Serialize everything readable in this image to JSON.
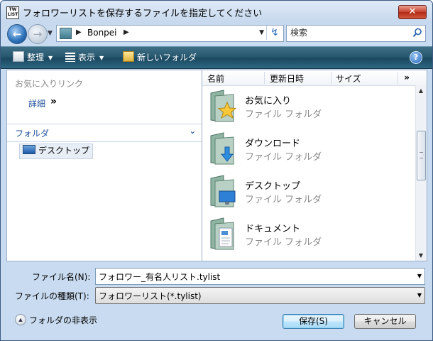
{
  "title": "フォロワーリストを保存するファイルを指定してください",
  "nav": {
    "path": [
      "Bonpei"
    ],
    "search_placeholder": "検索"
  },
  "toolbar": {
    "organize": "整理",
    "views": "表示",
    "new_folder": "新しいフォルダ"
  },
  "left": {
    "favorites_header": "お気に入りリンク",
    "details_label": "詳細",
    "details_chevron": "»",
    "folders_header": "フォルダ",
    "tree_items": [
      {
        "label": "デスクトップ"
      }
    ]
  },
  "columns": [
    "名前",
    "更新日時",
    "サイズ"
  ],
  "columns_more": "»",
  "items": [
    {
      "name": "お気に入り",
      "type": "ファイル フォルダ",
      "icon": "favorites-folder-icon"
    },
    {
      "name": "ダウンロード",
      "type": "ファイル フォルダ",
      "icon": "downloads-folder-icon"
    },
    {
      "name": "デスクトップ",
      "type": "ファイル フォルダ",
      "icon": "desktop-folder-icon"
    },
    {
      "name": "ドキュメント",
      "type": "ファイル フォルダ",
      "icon": "documents-folder-icon"
    }
  ],
  "form": {
    "filename_label": "ファイル名(N):",
    "filename_value": "フォロワー_有名人リスト.tylist",
    "filetype_label": "ファイルの種類(T):",
    "filetype_value": "フォロワーリスト(*.tylist)"
  },
  "footer": {
    "hide_folders": "フォルダの非表示",
    "save": "保存(S)",
    "cancel": "キャンセル"
  },
  "colors": {
    "toolbar": "#27576e",
    "link": "#1f4e9a",
    "close": "#c6422e"
  }
}
